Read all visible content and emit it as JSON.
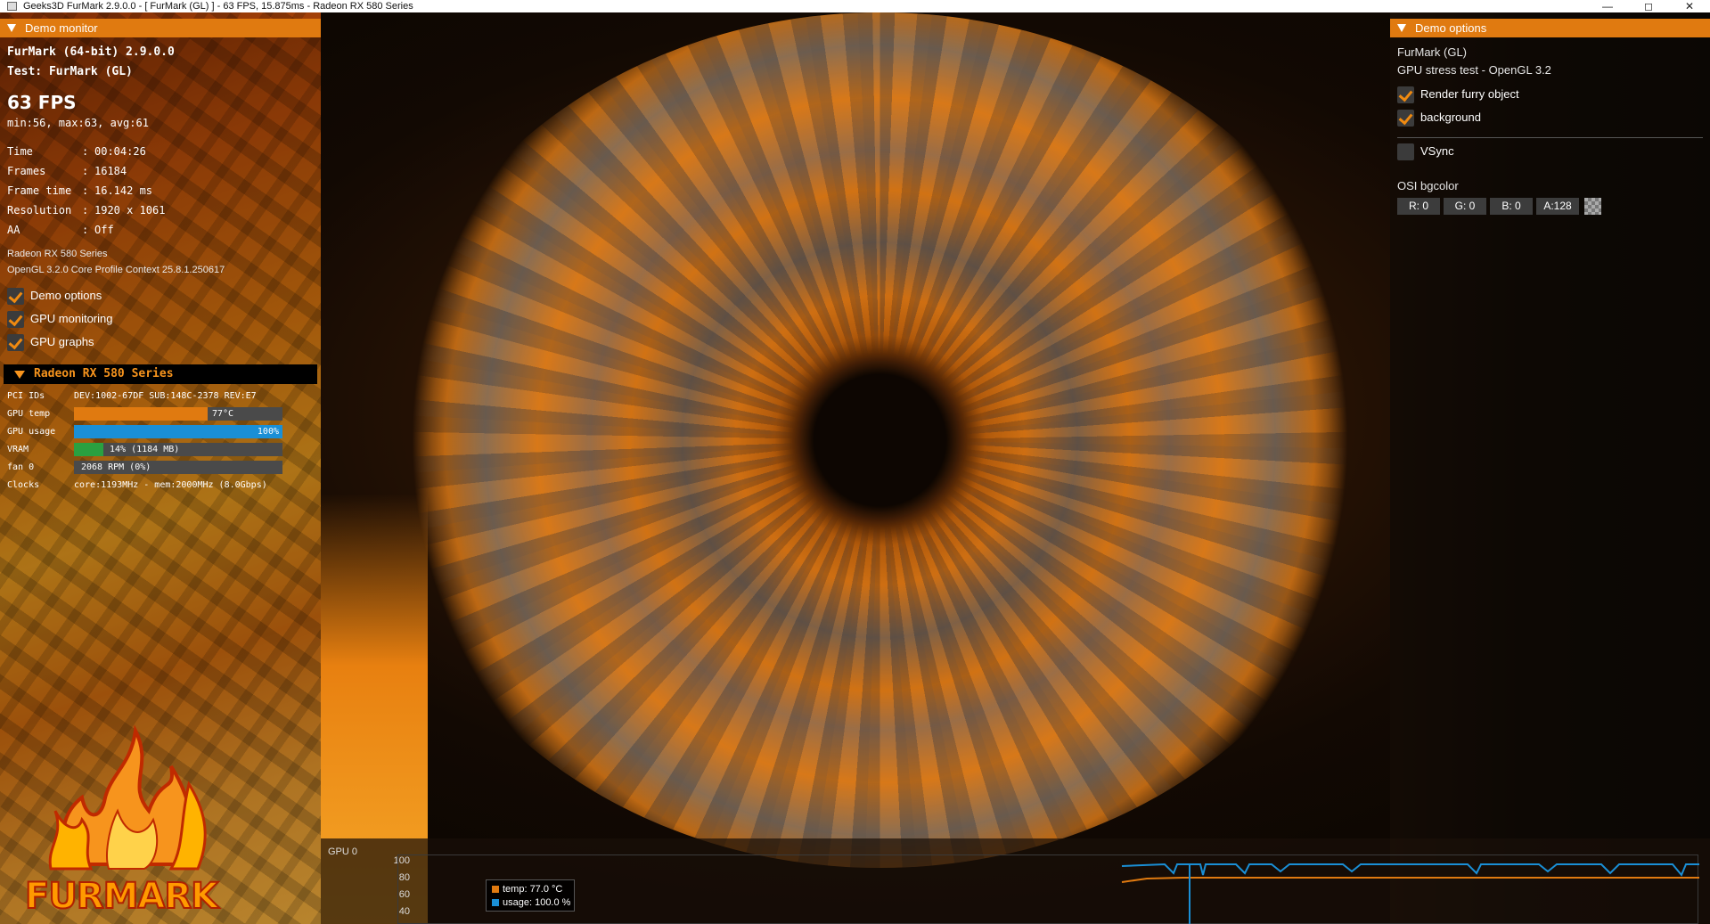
{
  "window": {
    "title": "Geeks3D FurMark 2.9.0.0 - [ FurMark (GL) ] - 63 FPS, 15.875ms - Radeon RX 580 Series"
  },
  "demo_monitor": {
    "header": "Demo monitor",
    "app_name": "FurMark (64-bit) 2.9.0.0",
    "test": "Test: FurMark (GL)",
    "fps": "63 FPS",
    "fps_stats": "min:56, max:63, avg:61",
    "stats": [
      {
        "label": "Time",
        "value": "00:04:26"
      },
      {
        "label": "Frames",
        "value": "16184"
      },
      {
        "label": "Frame time",
        "value": "16.142 ms"
      },
      {
        "label": "Resolution",
        "value": "1920 x 1061"
      },
      {
        "label": "AA",
        "value": "Off"
      }
    ],
    "gpu_name": "Radeon RX 580 Series",
    "gl_context": "OpenGL 3.2.0 Core Profile Context 25.8.1.250617",
    "checkboxes": [
      {
        "label": "Demo options",
        "checked": true
      },
      {
        "label": "GPU monitoring",
        "checked": true
      },
      {
        "label": "GPU graphs",
        "checked": true
      }
    ],
    "gpu_section": {
      "title": "Radeon RX 580 Series",
      "pci_label": "PCI IDs",
      "pci_value": "DEV:1002-67DF SUB:148C-2378 REV:E7",
      "temp_label": "GPU temp",
      "temp_value": "77°C",
      "temp_fraction": 0.64,
      "usage_label": "GPU usage",
      "usage_value": "100%",
      "usage_fraction": 1.0,
      "vram_label": "VRAM",
      "vram_value": "14% (1184 MB)",
      "vram_fraction": 0.14,
      "fan_label": "fan 0",
      "fan_value": "2068 RPM (0%)",
      "clocks_label": "Clocks",
      "clocks_value": "core:1193MHz - mem:2000MHz (8.0Gbps)"
    },
    "logo_text": "FURMARK"
  },
  "demo_options": {
    "header": "Demo options",
    "name": "FurMark (GL)",
    "description": "GPU stress test - OpenGL 3.2",
    "checkboxes": [
      {
        "label": "Render furry object",
        "checked": true
      },
      {
        "label": "background",
        "checked": true
      }
    ],
    "vsync": {
      "label": "VSync",
      "checked": false
    },
    "osi_label": "OSI bgcolor",
    "osi": {
      "r": "R: 0",
      "g": "G: 0",
      "b": "B: 0",
      "a": "A:128"
    }
  },
  "graph": {
    "title": "GPU 0",
    "y_ticks": [
      "100",
      "80",
      "60",
      "40"
    ],
    "legend": [
      {
        "label": "temp: 77.0 °C",
        "color": "#e07a10"
      },
      {
        "label": "usage: 100.0 %",
        "color": "#1a8fd6"
      }
    ]
  },
  "colors": {
    "accent": "#e07a10",
    "usage_bar": "#1a8fd6",
    "vram_bar": "#2aa040"
  }
}
